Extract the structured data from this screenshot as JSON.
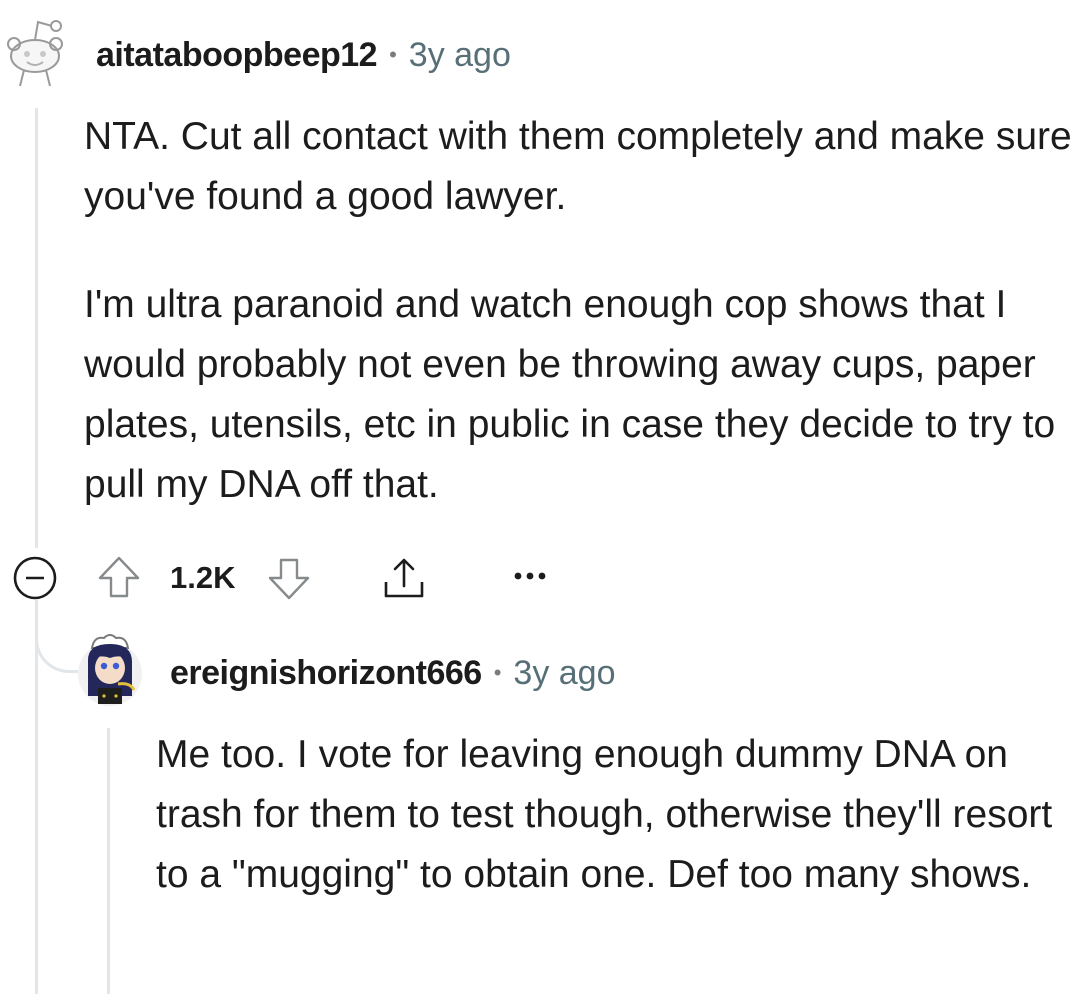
{
  "comment1": {
    "author": "aitataboopbeep12",
    "time": "3y ago",
    "paragraphs": [
      "NTA. Cut all contact with them completely and make sure you've found a good lawyer.",
      "I'm ultra paranoid and watch enough cop shows that I would probably not even be throwing away cups, paper plates, utensils, etc in public in case they decide to try to pull my DNA off that."
    ],
    "score": "1.2K",
    "icons": {
      "avatar": "snoo-avatar",
      "collapse": "collapse-minus-icon",
      "upvote": "upvote-arrow-icon",
      "downvote": "downvote-arrow-icon",
      "share": "share-icon",
      "more": "more-dots-icon"
    }
  },
  "comment2": {
    "author": "ereignishorizont666",
    "time": "3y ago",
    "paragraph": "Me too. I vote for leaving enough dummy DNA on trash for them to test though, otherwise they'll resort to a \"mugging\" to obtain one. Def too many shows."
  },
  "colors": {
    "text": "#1c1c1c",
    "meta": "#576f76",
    "thread_line": "#e3e6e8",
    "icon_gray": "#878a8c"
  }
}
